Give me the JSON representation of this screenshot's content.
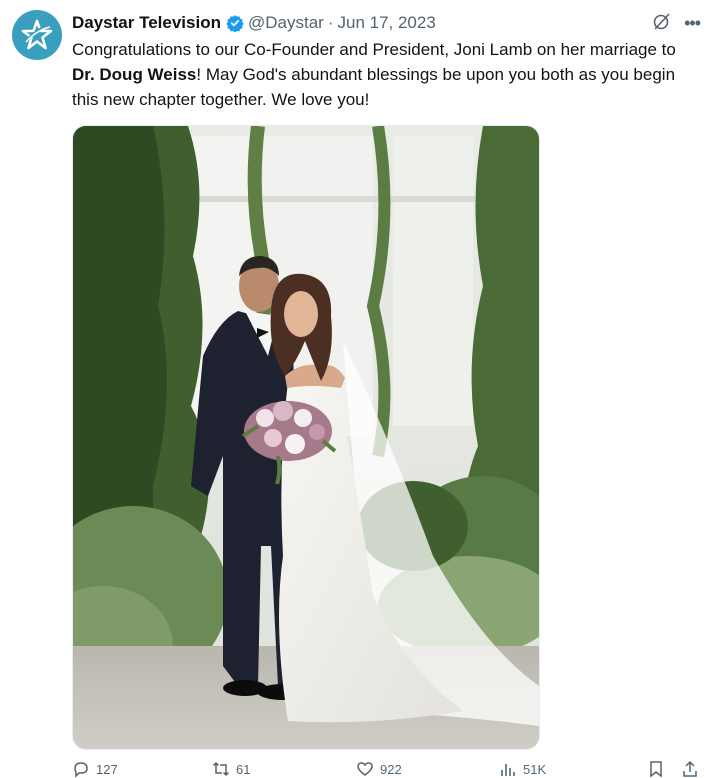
{
  "tweet": {
    "author_name": "Daystar Television",
    "handle": "@Daystar",
    "separator": "·",
    "date": "Jun 17, 2023",
    "text_part1": "Congratulations to our Co-Founder and President, Joni Lamb on her marriage to ",
    "text_bold": "Dr. Doug Weiss",
    "text_part2": "! May God's abundant blessings be upon you both as you begin this new chapter together. We love you!"
  },
  "icons": {
    "avatar": "daystar-star-logo",
    "verified": "verified-badge-icon",
    "grok": "grok-icon",
    "more": "more-icon",
    "reply": "reply-icon",
    "retweet": "retweet-icon",
    "like": "like-icon",
    "views": "views-icon",
    "bookmark": "bookmark-icon",
    "share": "share-icon"
  },
  "stats": {
    "replies": "127",
    "retweets": "61",
    "likes": "922",
    "views": "51K"
  },
  "colors": {
    "brand_avatar": "#3a9fbf",
    "verified": "#1d9bf0",
    "text": "#0f1419",
    "secondary": "#536471"
  }
}
